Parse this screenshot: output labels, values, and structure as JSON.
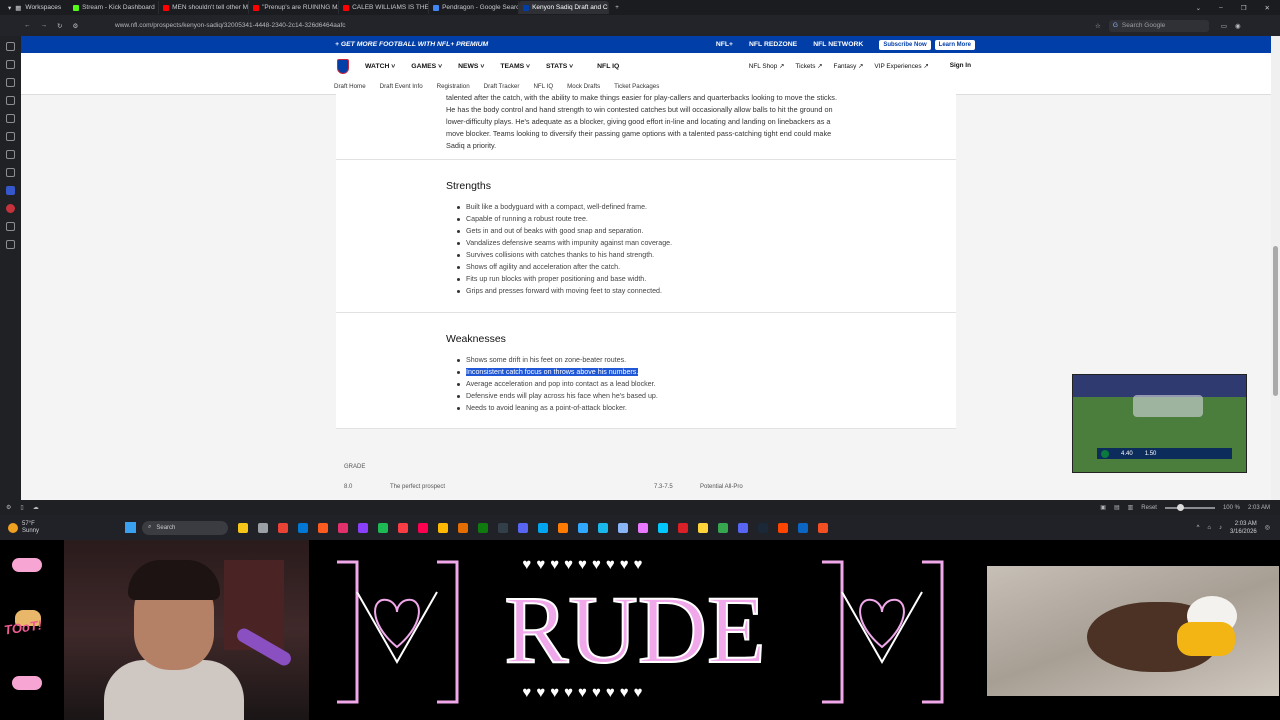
{
  "browser": {
    "workspace_label": "Workspaces",
    "tabs": [
      {
        "title": "Stream - Kick Dashboard",
        "color": "#53fc18"
      },
      {
        "title": "MEN shouldn't tell other M",
        "color": "#ff0000"
      },
      {
        "title": "\"Prenup's are RUINING MA",
        "color": "#ff0000"
      },
      {
        "title": "CALEB WILLIAMS IS THE M",
        "color": "#ff0000"
      },
      {
        "title": "Pendragon - Google Search",
        "color": "#4285f4"
      },
      {
        "title": "Kenyon Sadiq Draft and Co",
        "color": "#013ea7"
      }
    ],
    "url": "www.nfl.com/prospects/kenyon-sadiq/32005341-4448-2340-2c14-326d6464aafc",
    "search_placeholder": "Search Google",
    "zoom": {
      "reset_label": "Reset",
      "value_label": "100 %",
      "level": 100
    },
    "status_time": "2:03 AM"
  },
  "nfl": {
    "promo_text": "+ GET MORE FOOTBALL WITH NFL+ PREMIUM",
    "promo_links": [
      "NFL+",
      "NFL REDZONE",
      "NFL NETWORK"
    ],
    "subscribe_label": "Subscribe Now",
    "learn_label": "Learn More",
    "nav_main": [
      "WATCH",
      "GAMES",
      "NEWS",
      "TEAMS",
      "STATS"
    ],
    "nav_iq": "NFL IQ",
    "nav_right": [
      "NFL Shop ↗",
      "Tickets ↗",
      "Fantasy ↗",
      "VIP Experiences ↗"
    ],
    "sign_in": "Sign In",
    "subnav": [
      "Draft Home",
      "Draft Event Info",
      "Registration",
      "Draft Tracker",
      "NFL IQ",
      "Mock Drafts",
      "Ticket Packages"
    ]
  },
  "article": {
    "intro": "talented after the catch, with the ability to make things easier for play-callers and quarterbacks looking to move the sticks. He has the body control and hand strength to win contested catches but will occasionally allow balls to hit the ground on lower-difficulty plays. He's adequate as a blocker, giving good effort in-line and locating and landing on linebackers as a move blocker. Teams looking to diversify their passing game options with a talented pass-catching tight end could make Sadiq a priority.",
    "strengths_title": "Strengths",
    "strengths": [
      "Built like a bodyguard with a compact, well-defined frame.",
      "Capable of running a robust route tree.",
      "Gets in and out of beaks with good snap and separation.",
      "Vandalizes defensive seams with impunity against man coverage.",
      "Survives collisions with catches thanks to his hand strength.",
      "Shows off agility and acceleration after the catch.",
      "Fits up run blocks with proper positioning and base width.",
      "Grips and presses forward with moving feet to stay connected."
    ],
    "weaknesses_title": "Weaknesses",
    "weaknesses": [
      "Shows some drift in his feet on zone-beater routes.",
      "Inconsistent catch focus on throws above his numbers.",
      "Average acceleration and pop into contact as a lead blocker.",
      "Defensive ends will play across his face when he's based up.",
      "Needs to avoid leaning as a point-of-attack blocker."
    ],
    "grade_label": "GRADE",
    "grade_rows": [
      {
        "score": "8.0",
        "desc": "The perfect prospect",
        "score2": "7.3-7.5",
        "desc2": "Potential All-Pro"
      }
    ]
  },
  "video": {
    "score_a": "4.40",
    "score_b": "1.50"
  },
  "taskbar": {
    "weather_temp": "57°F",
    "weather_desc": "Sunny",
    "search_label": "Search",
    "time": "2:03 AM",
    "date": "3/16/2026",
    "app_colors": [
      "#f5c518",
      "#9aa0a6",
      "#ea4335",
      "#0078d4",
      "#ff5a1f",
      "#e1306c",
      "#8a3ffc",
      "#1db954",
      "#fc3c44",
      "#ff0050",
      "#ffb900",
      "#e36d00",
      "#0f7b0f",
      "#333f48",
      "#5865f2",
      "#00a4ef",
      "#ff7a00",
      "#31a8ff",
      "#1ab7ea",
      "#8ab4f8",
      "#ea77ff",
      "#00c8ff",
      "#da1f26",
      "#ffd43b",
      "#36a64f",
      "#5865f2",
      "#1b2838",
      "#ff4500",
      "#0a66c2",
      "#f25022"
    ]
  },
  "overlay": {
    "brand_text": "RUDE",
    "hearts_row": "♥♥♥♥♥♥♥♥♥",
    "toot_text": "TOoT!",
    "accent": "#f0a8ea"
  }
}
